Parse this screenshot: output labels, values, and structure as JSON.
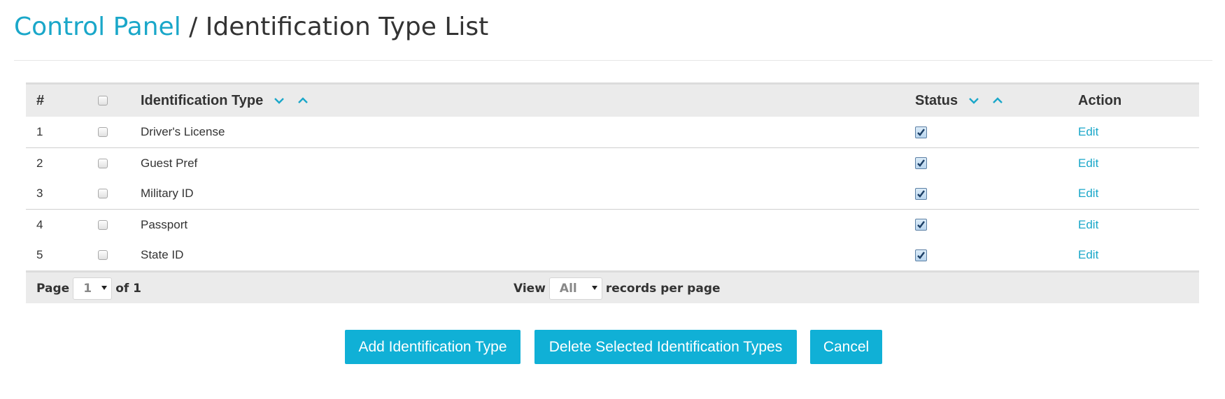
{
  "breadcrumb": {
    "root": "Control Panel",
    "separator": " / ",
    "current": "Identification Type List"
  },
  "table": {
    "columns": {
      "number": "#",
      "type": "Identification Type",
      "status": "Status",
      "action": "Action"
    },
    "rows": [
      {
        "num": "1",
        "type": "Driver's License",
        "status_checked": true,
        "action": "Edit"
      },
      {
        "num": "2",
        "type": "Guest Pref",
        "status_checked": true,
        "action": "Edit"
      },
      {
        "num": "3",
        "type": "Military ID",
        "status_checked": true,
        "action": "Edit"
      },
      {
        "num": "4",
        "type": "Passport",
        "status_checked": true,
        "action": "Edit"
      },
      {
        "num": "5",
        "type": "State ID",
        "status_checked": true,
        "action": "Edit"
      }
    ]
  },
  "pager": {
    "page_label": "Page",
    "page_value": "1",
    "of_label": "of 1",
    "view_label": "View",
    "view_value": "All",
    "records_label": "records per page"
  },
  "actions": {
    "add": "Add Identification Type",
    "delete": "Delete Selected Identification Types",
    "cancel": "Cancel"
  },
  "colors": {
    "accent": "#10b0d6",
    "link": "#1aa7c9",
    "header_bg": "#ebebeb"
  },
  "icons": {
    "sort_desc": "chevron-down-icon",
    "sort_asc": "chevron-up-icon",
    "status_checked": "checkbox-checked-icon"
  }
}
